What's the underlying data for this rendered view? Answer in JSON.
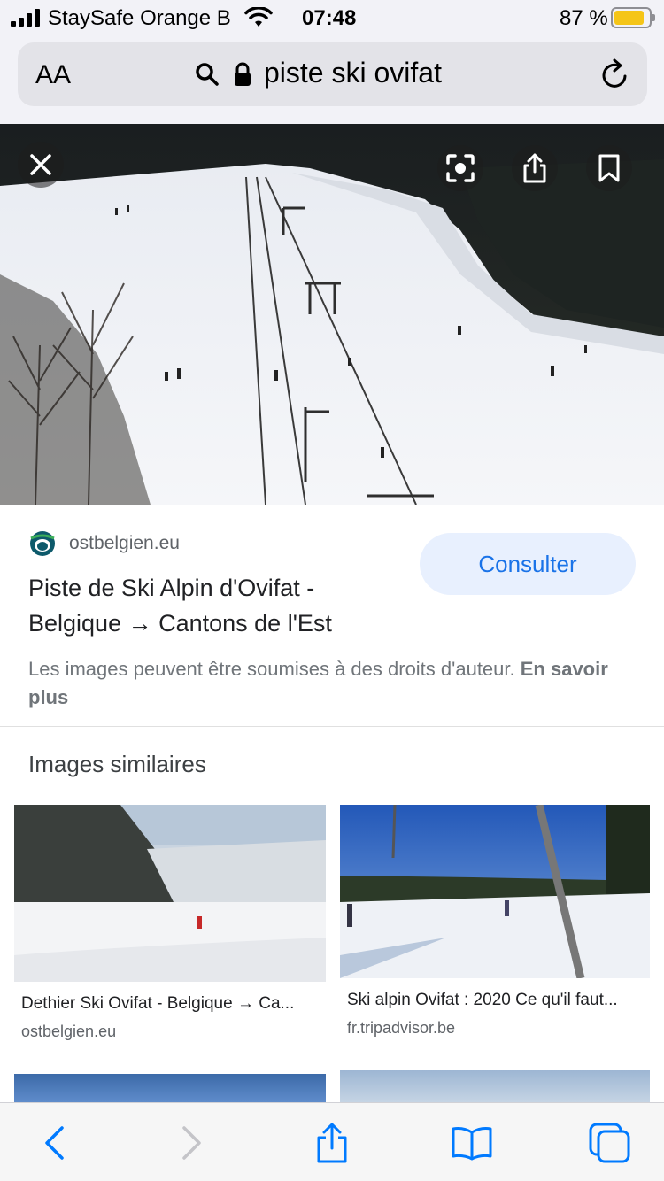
{
  "status_bar": {
    "carrier": "StaySafe Orange B",
    "time": "07:48",
    "battery_percent": "87 %",
    "battery_level": 0.87
  },
  "url_bar": {
    "reader_label": "AA",
    "url": "piste ski ovifat"
  },
  "result": {
    "source": "ostbelgien.eu",
    "title": "Piste de Ski Alpin d'Ovifat - Belgique → Cantons de l'Est",
    "consult_label": "Consulter",
    "copyright_text": "Les images peuvent être soumises à des droits d'auteur.",
    "learn_more": "En savoir plus"
  },
  "similar": {
    "heading": "Images similaires",
    "items": [
      {
        "caption": "Dethier Ski Ovifat - Belgique → Ca...",
        "source": "ostbelgien.eu"
      },
      {
        "caption": "Ski alpin Ovifat : 2020 Ce qu'il faut...",
        "source": "fr.tripadvisor.be"
      }
    ]
  },
  "colors": {
    "accent": "#1a73e8",
    "consult_bg": "#e8f0fe",
    "battery": "#f5c518",
    "ios_blue": "#007aff"
  },
  "icons": {
    "close": "close-icon",
    "lens": "lens-icon",
    "share": "share-icon",
    "bookmark": "bookmark-icon",
    "back": "back-icon",
    "forward": "forward-icon",
    "bookmarks": "bookmarks-icon",
    "tabs": "tabs-icon"
  }
}
